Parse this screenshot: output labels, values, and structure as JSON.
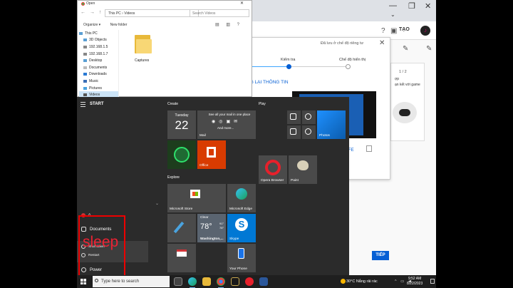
{
  "explorer": {
    "title": "Open",
    "breadcrumb": [
      "This PC",
      "Videos"
    ],
    "search_placeholder": "Search Videos",
    "toolbar": {
      "organize": "Organize ▾",
      "new_folder": "New folder"
    },
    "sidebar": [
      "This PC",
      "3D Objects",
      "192.168.1.5",
      "192.168.1.7",
      "Desktop",
      "Documents",
      "Downloads",
      "Music",
      "Pictures",
      "Videos"
    ],
    "folder": {
      "name": "Captures"
    }
  },
  "browser": {
    "create_label": "TẠO"
  },
  "upload_dialog": {
    "saved_text": "Đã lưu ở chế độ riêng tư",
    "steps": [
      {
        "label": "Kiểm tra"
      },
      {
        "label": "Chế độ hiển thị"
      }
    ],
    "heading_partial": "NG LẠI THÔNG TIN",
    "link_partial": "FE",
    "pager": "1 / 2",
    "side_card_text": [
      "ợp",
      "ạn kết với game"
    ],
    "next_button": "TIẾP"
  },
  "start_menu": {
    "title": "START",
    "rail": {
      "user_initial": "A",
      "documents": "Documents",
      "shut_down": "Shut down",
      "restart": "Restart",
      "power": "Power"
    },
    "annotation": "sleep",
    "groups": {
      "create": "Create",
      "play": "Play",
      "explore": "Explore"
    },
    "tiles": {
      "calendar_day": "Tuesday",
      "calendar_date": "22",
      "mail_heading": "See all your mail in one place",
      "mail_more": "And more...",
      "mail_label": "Mail",
      "office": "Office",
      "opera": "Opera Browser",
      "paint": "Paint",
      "photos": "Photos",
      "microsoft_store": "Microsoft Store",
      "microsoft_edge": "Microsoft Edge",
      "weather_condition": "Clear",
      "weather_temp": "78°",
      "weather_high": "91°",
      "weather_low": "78°",
      "weather_city": "Washington,...",
      "skype": "Skype",
      "your_phone": "Your Phone"
    }
  },
  "taskbar": {
    "search_placeholder": "Type here to search",
    "weather": "30°C  Nắng rải rác",
    "time": "9:52 AM",
    "date": "8/22/2023"
  }
}
